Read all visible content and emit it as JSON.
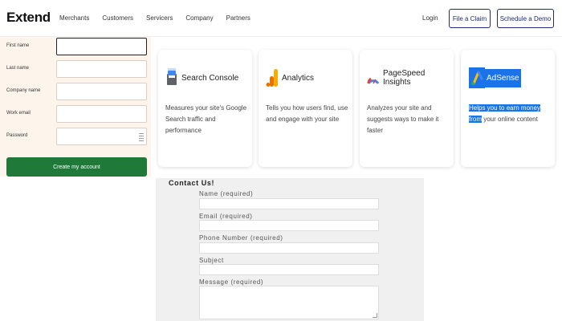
{
  "header": {
    "logo": "Extend",
    "nav": [
      "Merchants",
      "Customers",
      "Servicers",
      "Company",
      "Partners"
    ],
    "login": "Login",
    "file_claim": "File a Claim",
    "schedule_demo": "Schedule a Demo"
  },
  "signup": {
    "fields": [
      {
        "label": "First name",
        "value": ""
      },
      {
        "label": "Last name",
        "value": ""
      },
      {
        "label": "Company name",
        "value": ""
      },
      {
        "label": "Work email",
        "value": ""
      },
      {
        "label": "Password",
        "value": ""
      }
    ],
    "submit": "Create my account"
  },
  "cards": [
    {
      "title": "Search Console",
      "desc": "Measures your site's Google Search traffic and performance",
      "icon": "search-console-icon"
    },
    {
      "title": "Analytics",
      "desc": "Tells you how users find, use and engage with your site",
      "icon": "analytics-icon"
    },
    {
      "title": "PageSpeed Insights",
      "desc": "Analyzes your site and suggests ways to make it faster",
      "icon": "pagespeed-icon"
    },
    {
      "title": "AdSense",
      "desc_highlight": "Helps you to earn money from",
      "desc_rest": "your online content",
      "icon": "adsense-icon"
    }
  ],
  "contact": {
    "title": "Contact Us!",
    "name_label": "Name (required)",
    "email_label": "Email (required)",
    "phone_label": "Phone Number (required)",
    "subject_label": "Subject",
    "message_label": "Message (required)"
  },
  "colors": {
    "brand_navy": "#1d2a78",
    "create_button": "#1f7a3a",
    "signup_bg": "#fdf4ec",
    "adsense_blue": "#1a73e8"
  }
}
